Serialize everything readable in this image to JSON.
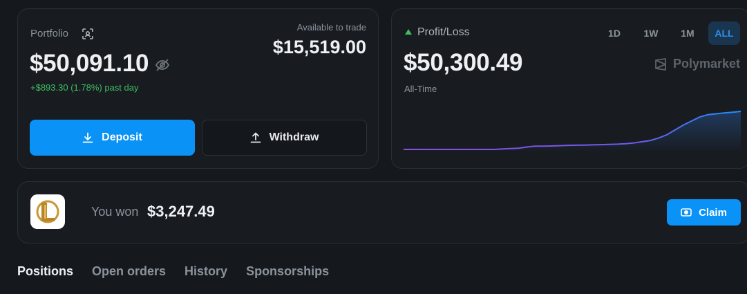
{
  "portfolio": {
    "label": "Portfolio",
    "value": "$50,091.10",
    "change": "+$893.30 (1.78%) past day",
    "available_label": "Available to trade",
    "available_value": "$15,519.00",
    "deposit_label": "Deposit",
    "withdraw_label": "Withdraw"
  },
  "pnl": {
    "label": "Profit/Loss",
    "value": "$50,300.49",
    "sublabel": "All-Time",
    "brand": "Polymarket",
    "ranges": [
      "1D",
      "1W",
      "1M",
      "ALL"
    ],
    "active_range": "ALL"
  },
  "chart_data": {
    "type": "line",
    "x_order": "chronological",
    "values": [
      0,
      0,
      0,
      0,
      0,
      0,
      0,
      0,
      0,
      0,
      0,
      0,
      0.5,
      1,
      1.5,
      3,
      4,
      4,
      4.3,
      4.6,
      5,
      5.2,
      5.4,
      5.6,
      5.9,
      6.2,
      6.5,
      7,
      8,
      9.5,
      11,
      14,
      18,
      24,
      30,
      35,
      40,
      43,
      44,
      45,
      46,
      47
    ],
    "colors": {
      "start": "#8a4fe3",
      "end": "#1e90ff"
    }
  },
  "won": {
    "text": "You won",
    "amount": "$3,247.49",
    "claim_label": "Claim"
  },
  "nav": {
    "tabs": [
      "Positions",
      "Open orders",
      "History",
      "Sponsorships"
    ],
    "active": "Positions"
  }
}
